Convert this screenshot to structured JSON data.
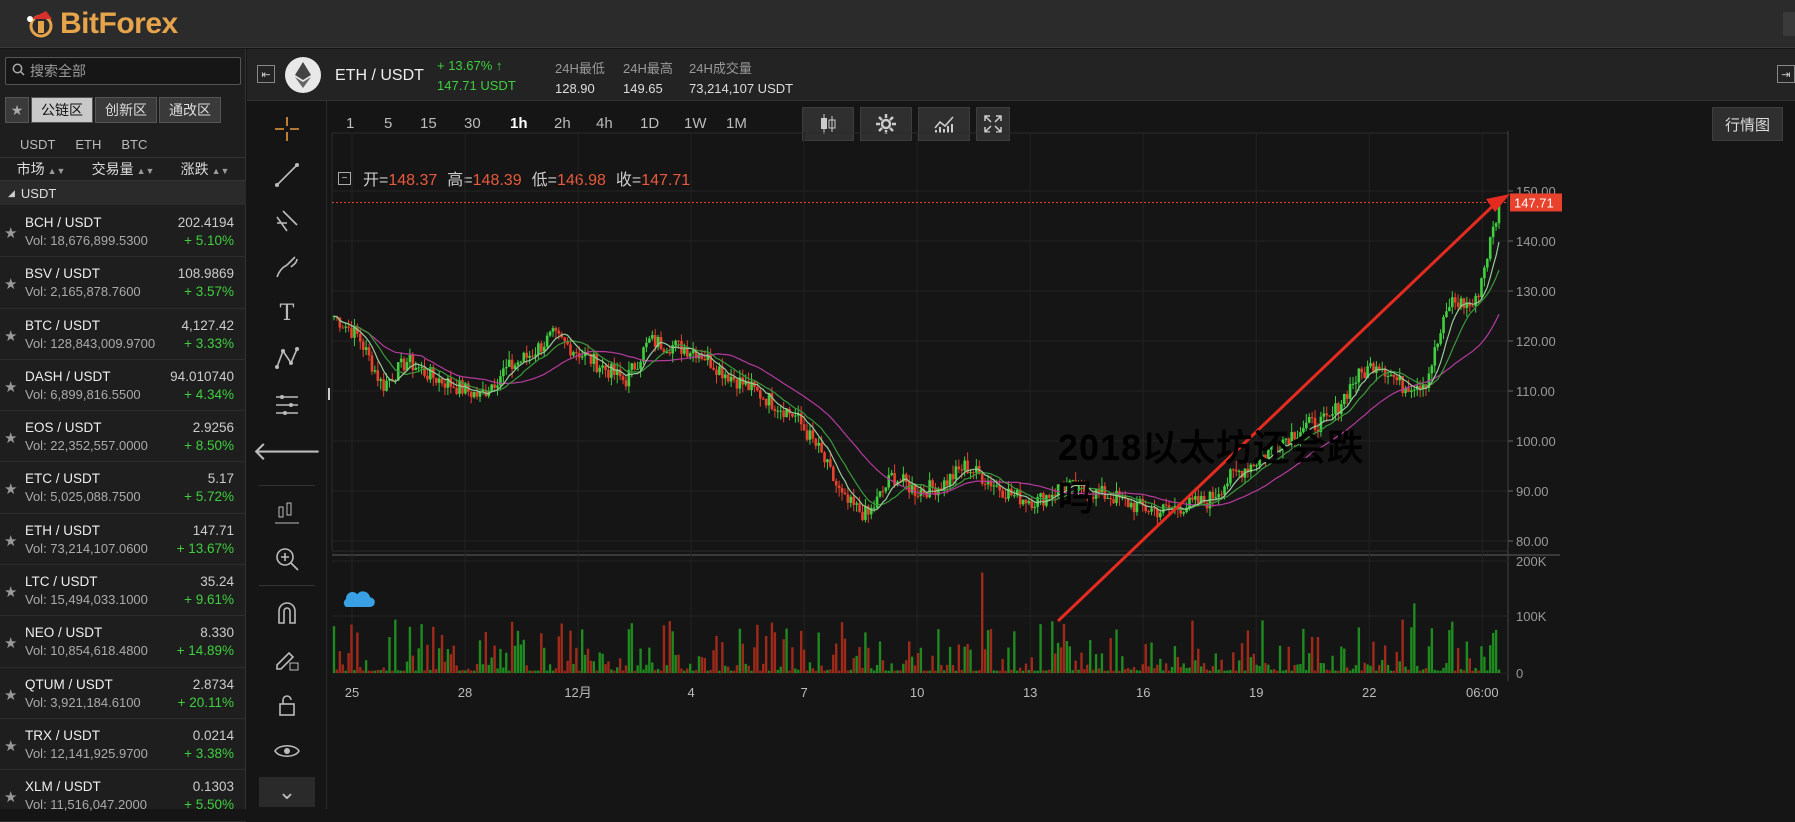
{
  "app": {
    "logo_text": "BitForex"
  },
  "sidebar": {
    "search_placeholder": "搜索全部",
    "zones": [
      "公链区",
      "创新区",
      "通改区"
    ],
    "quote_tabs": [
      "USDT",
      "ETH",
      "BTC"
    ],
    "columns": [
      "市场",
      "交易量",
      "涨跌"
    ],
    "group": "USDT",
    "markets": [
      {
        "pair": "BCH / USDT",
        "vol": "Vol: 18,676,899.5300",
        "price": "202.4194",
        "change": "+ 5.10%"
      },
      {
        "pair": "BSV / USDT",
        "vol": "Vol: 2,165,878.7600",
        "price": "108.9869",
        "change": "+ 3.57%"
      },
      {
        "pair": "BTC / USDT",
        "vol": "Vol: 128,843,009.9700",
        "price": "4,127.42",
        "change": "+ 3.33%"
      },
      {
        "pair": "DASH / USDT",
        "vol": "Vol: 6,899,816.5500",
        "price": "94.010740",
        "change": "+ 4.34%"
      },
      {
        "pair": "EOS / USDT",
        "vol": "Vol: 22,352,557.0000",
        "price": "2.9256",
        "change": "+ 8.50%"
      },
      {
        "pair": "ETC / USDT",
        "vol": "Vol: 5,025,088.7500",
        "price": "5.17",
        "change": "+ 5.72%"
      },
      {
        "pair": "ETH / USDT",
        "vol": "Vol: 73,214,107.0600",
        "price": "147.71",
        "change": "+ 13.67%"
      },
      {
        "pair": "LTC / USDT",
        "vol": "Vol: 15,494,033.1000",
        "price": "35.24",
        "change": "+ 9.61%"
      },
      {
        "pair": "NEO / USDT",
        "vol": "Vol: 10,854,618.4800",
        "price": "8.330",
        "change": "+ 14.89%"
      },
      {
        "pair": "QTUM / USDT",
        "vol": "Vol: 3,921,184.6100",
        "price": "2.8734",
        "change": "+ 20.11%"
      },
      {
        "pair": "TRX / USDT",
        "vol": "Vol: 12,141,925.9700",
        "price": "0.0214",
        "change": "+ 3.38%"
      },
      {
        "pair": "XLM / USDT",
        "vol": "Vol: 11,516,047.2000",
        "price": "0.1303",
        "change": "+ 5.50%"
      }
    ]
  },
  "header": {
    "pair": "ETH / USDT",
    "change": "+ 13.67%",
    "price": "147.71 USDT",
    "stats": [
      {
        "label": "24H最低",
        "value": "128.90"
      },
      {
        "label": "24H最高",
        "value": "149.65"
      },
      {
        "label": "24H成交量",
        "value": "73,214,107 USDT"
      }
    ]
  },
  "toolbar": {
    "timeframes": [
      "1",
      "5",
      "15",
      "30",
      "1h",
      "2h",
      "4h",
      "1D",
      "1W",
      "1M"
    ],
    "active_timeframe": "1h",
    "market_button": "行情图"
  },
  "ohlc": {
    "open_label": "开=",
    "open": "148.37",
    "high_label": "高=",
    "high": "148.39",
    "low_label": "低=",
    "low": "146.98",
    "close_label": "收=",
    "close": "147.71"
  },
  "overlay_text": "2018以太坊还会跌吗",
  "colors": {
    "up": "#3fcf3f",
    "down": "#e8412c",
    "price_line": "#e8412c",
    "ma_pink": "#b63a9e",
    "ma_green": "#3a9a3a"
  },
  "chart_data": {
    "type": "candlestick",
    "price_axis": {
      "ticks": [
        "150.00",
        "140.00",
        "130.00",
        "120.00",
        "110.00",
        "100.00",
        "90.00",
        "80.00"
      ],
      "range": [
        78,
        152
      ]
    },
    "volume_axis": {
      "ticks": [
        "200K",
        "100K",
        "0"
      ],
      "range": [
        0,
        200000
      ]
    },
    "x_ticks": [
      "25",
      "28",
      "12月",
      "4",
      "7",
      "10",
      "13",
      "16",
      "19",
      "22",
      "06:00"
    ],
    "last_price": "147.71",
    "close_path": [
      125,
      121,
      111,
      116,
      113,
      111,
      109,
      114,
      117,
      121,
      118,
      115,
      112,
      120,
      119,
      118,
      114,
      111,
      108,
      105,
      98,
      88,
      85,
      93,
      90,
      91,
      95,
      92,
      89,
      88,
      91,
      90,
      89,
      87,
      86,
      87,
      88,
      93,
      96,
      100,
      103,
      104,
      112,
      116,
      111,
      112,
      128,
      127,
      147
    ],
    "annotation": "arrow from 10 to 06:00"
  }
}
